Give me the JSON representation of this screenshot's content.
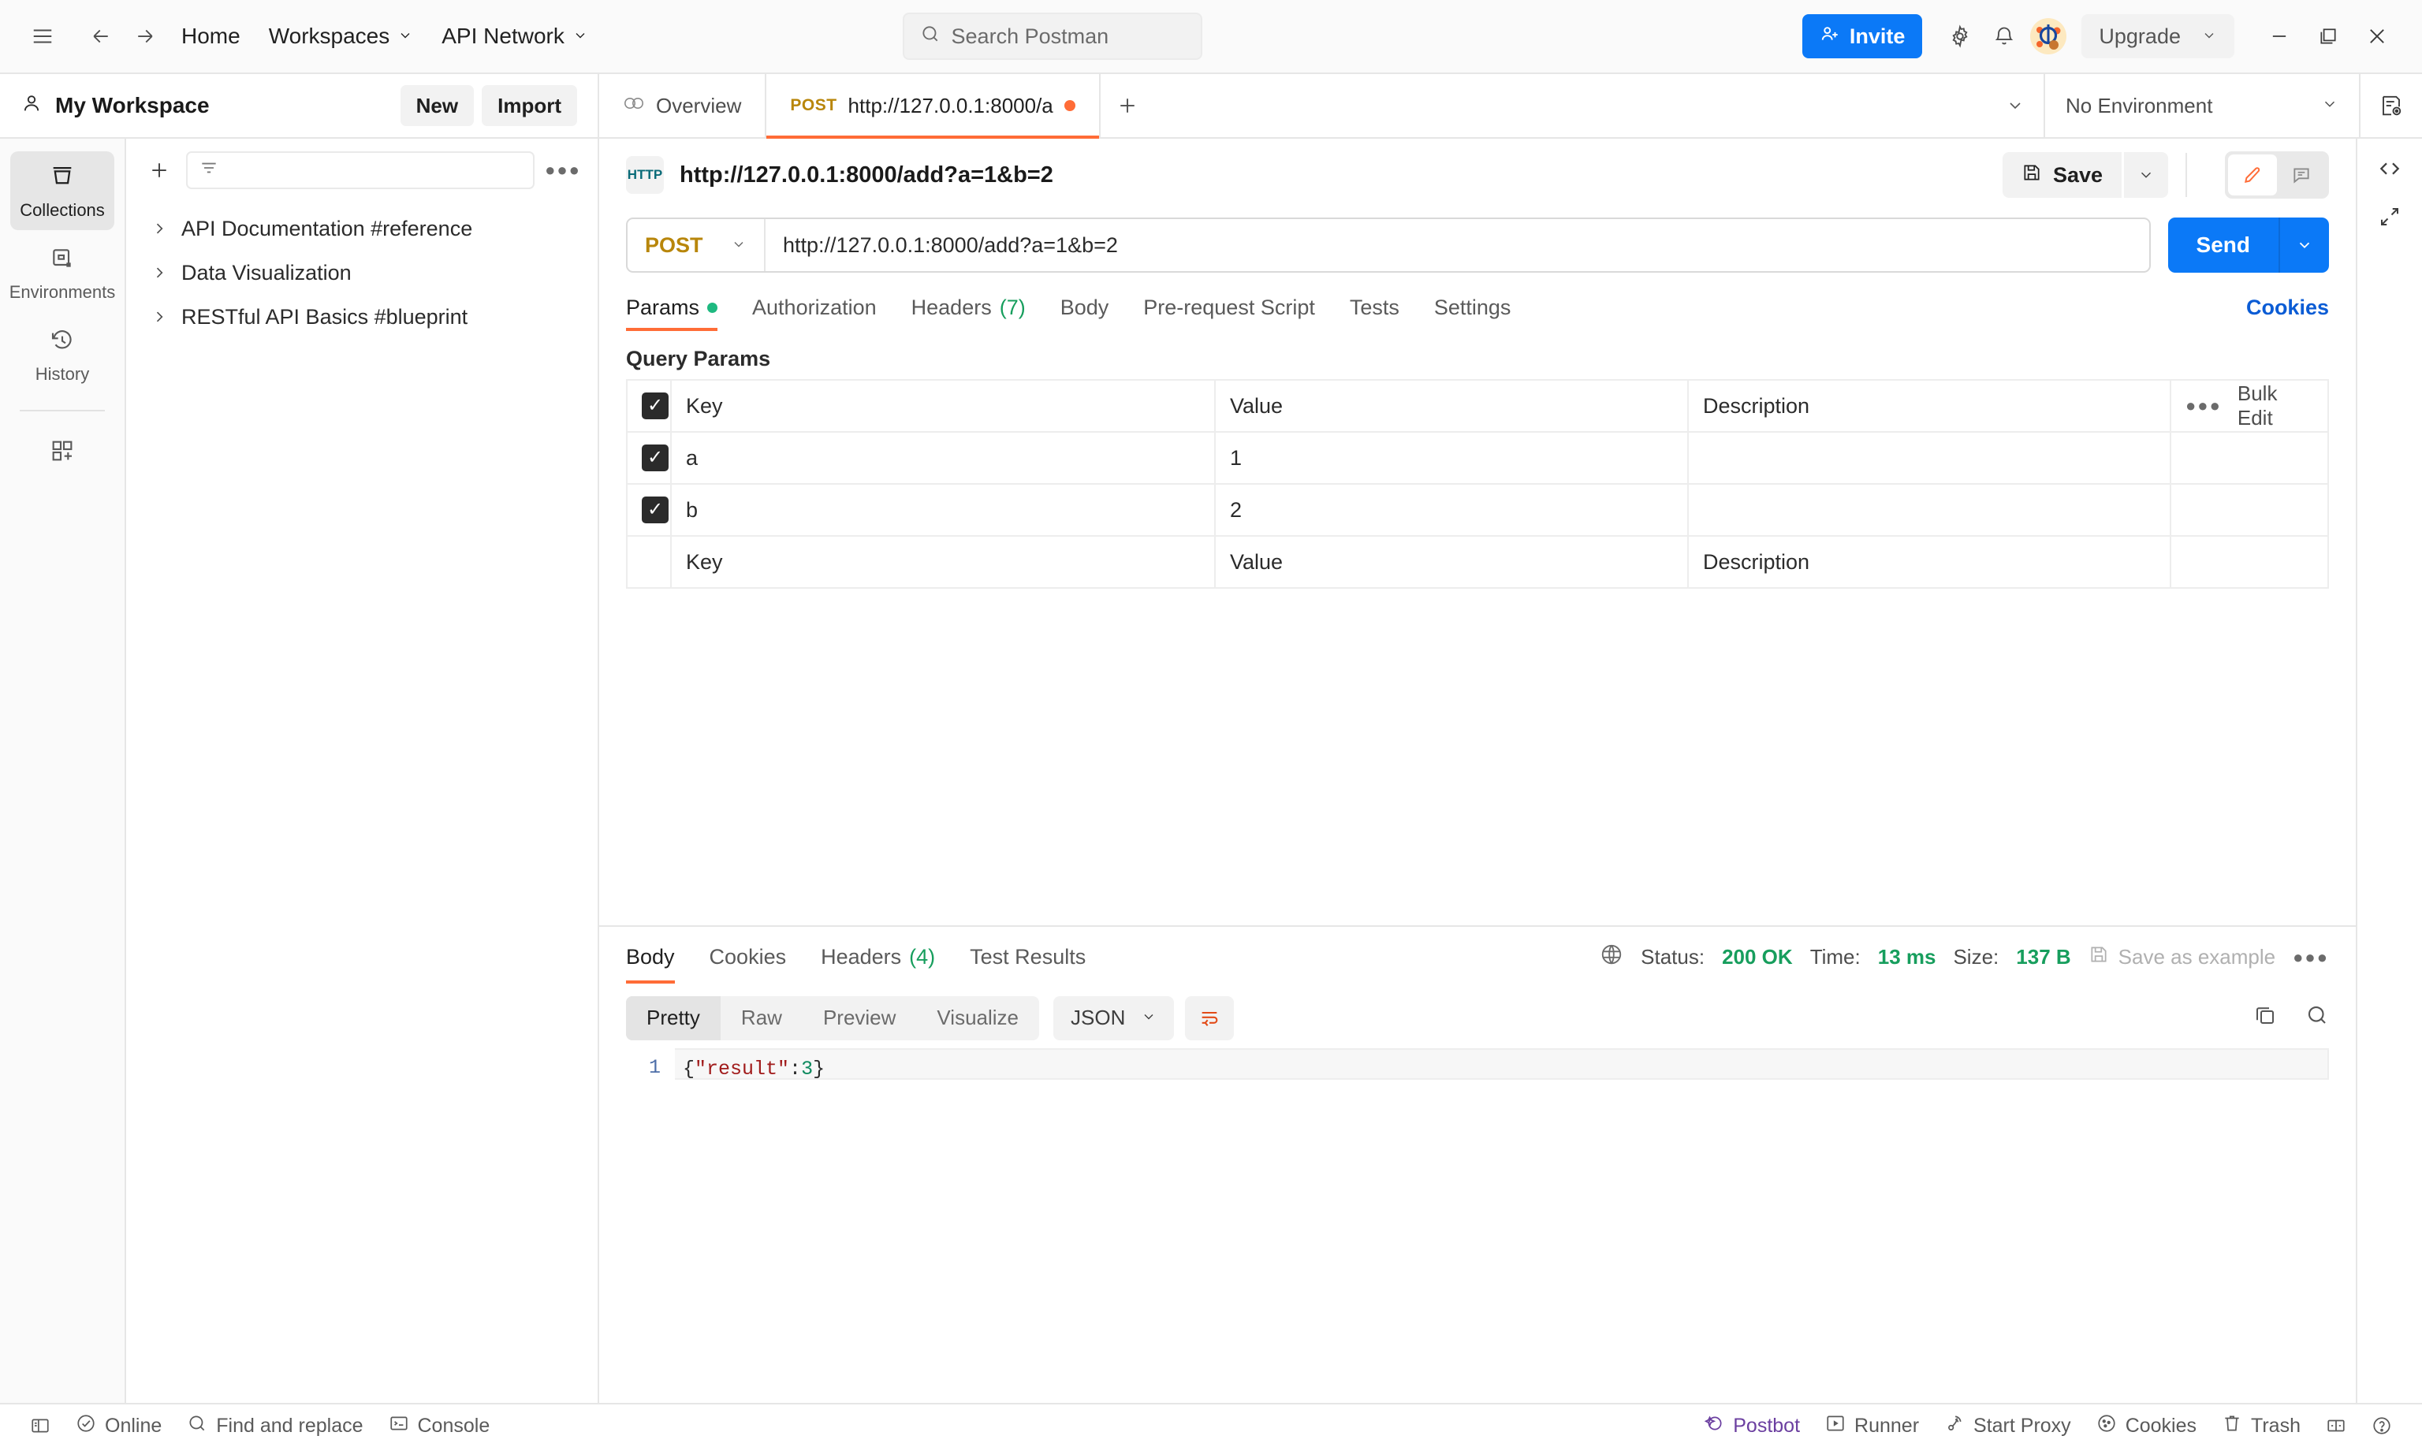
{
  "topbar": {
    "home_label": "Home",
    "workspaces_label": "Workspaces",
    "api_network_label": "API Network",
    "search_placeholder": "Search Postman",
    "invite_label": "Invite",
    "upgrade_label": "Upgrade"
  },
  "workspace": {
    "name": "My Workspace",
    "new_label": "New",
    "import_label": "Import"
  },
  "tabs": {
    "overview_label": "Overview",
    "request_method": "POST",
    "request_title": "http://127.0.0.1:8000/a",
    "environment_label": "No Environment"
  },
  "rail": {
    "items": [
      {
        "label": "Collections",
        "icon": "collections-icon"
      },
      {
        "label": "Environments",
        "icon": "environments-icon"
      },
      {
        "label": "History",
        "icon": "history-icon"
      }
    ]
  },
  "sidebar": {
    "filter_placeholder": "",
    "collections": [
      {
        "name": "API Documentation #reference"
      },
      {
        "name": "Data Visualization"
      },
      {
        "name": "RESTful API Basics #blueprint"
      }
    ]
  },
  "request": {
    "badge": "HTTP",
    "title": "http://127.0.0.1:8000/add?a=1&b=2",
    "save_label": "Save",
    "method": "POST",
    "url": "http://127.0.0.1:8000/add?a=1&b=2",
    "send_label": "Send",
    "cookies_label": "Cookies",
    "tabs": [
      {
        "label": "Params",
        "badge": "dot",
        "active": true
      },
      {
        "label": "Authorization",
        "badge": "",
        "active": false
      },
      {
        "label": "Headers",
        "badge": "(7)",
        "active": false
      },
      {
        "label": "Body",
        "badge": "",
        "active": false
      },
      {
        "label": "Pre-request Script",
        "badge": "",
        "active": false
      },
      {
        "label": "Tests",
        "badge": "",
        "active": false
      },
      {
        "label": "Settings",
        "badge": "",
        "active": false
      }
    ],
    "query_params_label": "Query Params",
    "table": {
      "headers": {
        "key": "Key",
        "value": "Value",
        "description": "Description"
      },
      "bulk_edit_label": "Bulk Edit",
      "rows": [
        {
          "checked": true,
          "key": "a",
          "value": "1",
          "description": ""
        },
        {
          "checked": true,
          "key": "b",
          "value": "2",
          "description": ""
        }
      ],
      "placeholder_row": {
        "key": "Key",
        "value": "Value",
        "description": "Description"
      }
    }
  },
  "response": {
    "tabs": [
      {
        "label": "Body",
        "badge": "",
        "active": true
      },
      {
        "label": "Cookies",
        "badge": "",
        "active": false
      },
      {
        "label": "Headers",
        "badge": "(4)",
        "active": false
      },
      {
        "label": "Test Results",
        "badge": "",
        "active": false
      }
    ],
    "status_label": "Status:",
    "status_value": "200 OK",
    "time_label": "Time:",
    "time_value": "13 ms",
    "size_label": "Size:",
    "size_value": "137 B",
    "save_as_example_label": "Save as example",
    "viewer_tabs": [
      {
        "label": "Pretty",
        "active": true
      },
      {
        "label": "Raw",
        "active": false
      },
      {
        "label": "Preview",
        "active": false
      },
      {
        "label": "Visualize",
        "active": false
      }
    ],
    "format_label": "JSON",
    "line_number": "1",
    "body_tokens": {
      "open": "{",
      "key": "\"result\"",
      "colon": ":",
      "num": "3",
      "close": "}"
    }
  },
  "statusbar": {
    "online_label": "Online",
    "find_replace_label": "Find and replace",
    "console_label": "Console",
    "postbot_label": "Postbot",
    "runner_label": "Runner",
    "start_proxy_label": "Start Proxy",
    "cookies_label": "Cookies",
    "trash_label": "Trash"
  },
  "colors": {
    "accent_orange": "#ff6c37",
    "primary_blue": "#0b79f7",
    "success_green": "#179e5d",
    "method_post": "#b8860b"
  }
}
